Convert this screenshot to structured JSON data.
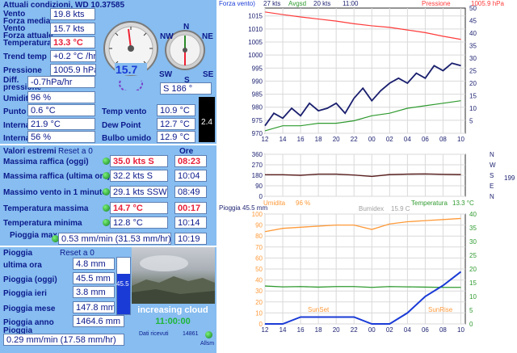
{
  "current": {
    "title": "Attuali condizioni, WD 10.37585",
    "vento_label": "Vento",
    "vento_value": "19.8 kts",
    "forza_media_label": "Forza media",
    "vento2_label": "Vento",
    "vento2_value": "15.7 kts",
    "forza_attuale_label": "Forza attuale",
    "temperatura_label": "Temperatura",
    "temperatura_value": "13.3 °C",
    "trend_label": "Trend temp",
    "trend_value": "+0.2 °C /hr",
    "pressione_label": "Pressione",
    "pressione_value": "1005.9 hPa",
    "diff_label1": "Diff.",
    "diff_label2": "pressione",
    "diff_value": "-0.7hPa/hr",
    "umidita_label": "Umidita",
    "umidita_value": "96 %",
    "punto_label": "Punto dep.",
    "punto_value": "0.6 °C",
    "interna_temp_label": "Interna temp.",
    "interna_temp_value": "21.9 °C",
    "interna_hum_label": "Interna hum",
    "interna_hum_value": "56 %",
    "temp_vento_label": "Temp vento",
    "temp_vento_value": "10.9 °C",
    "dew_label": "Dew Point",
    "dew_value": "12.7 °C",
    "bulbo_label": "Bulbo umido",
    "bulbo_value": "12.9 °C",
    "gauge_speed": "15.7",
    "compass_N": "N",
    "compass_NE": "NE",
    "compass_NW": "NW",
    "compass_SW": "SW",
    "compass_SE": "SE",
    "compass_S": "S",
    "compass_readout": "S   186 °",
    "uv_value": "2.4"
  },
  "extremes": {
    "title": "Valori estremi",
    "reset": "Reset a 0",
    "ore_label": "Ore",
    "rows": [
      {
        "label": "Massima raffica (oggi)",
        "value": "35.0 kts   S",
        "time": "08:23",
        "red": true
      },
      {
        "label": "Massima raffica (ultima ora)",
        "value": "32.2 kts   S",
        "time": "10:04",
        "red": false
      },
      {
        "label": "Massimo vento in 1 minuto",
        "value": "29.1 kts SSW",
        "time": "08:49",
        "red": false
      },
      {
        "label": "Temperatura massima",
        "value": "14.7 °C",
        "time": "00:17",
        "red": true
      },
      {
        "label": "Temperatura minima",
        "value": "12.8 °C",
        "time": "10:14",
        "red": false
      }
    ],
    "pioggia_max_label": "Pioggia max",
    "pioggia_max_value": "0.53 mm/min (31.53 mm/hr)",
    "pioggia_max_time": "10:19"
  },
  "rain": {
    "title": "Pioggia",
    "reset": "Reset a 0",
    "ultima_ora_label": "ultima ora",
    "ultima_ora_value": "4.8 mm",
    "oggi_label": "Pioggia (oggi)",
    "oggi_value": "45.5 mm",
    "ieri_label": "Pioggia ieri",
    "ieri_value": "3.8 mm",
    "mese_label": "Pioggia mese",
    "mese_value": "147.8 mm",
    "anno_label": "Pioggia anno",
    "anno_value": "1464.6 mm",
    "pioggia_label": "Pioggia",
    "pioggia_value": "0.29 mm/min (17.58 mm/hr)",
    "bar_value": "45.5",
    "bar_fraction": 0.72
  },
  "status": {
    "condition": "increasing cloud",
    "time": "11:00:00",
    "dati_label": "Dati ricevuti",
    "dati_count": "14861",
    "allsm": "Allsm"
  },
  "colors": {
    "panel": "#87bdf0",
    "label": "#0b1a8c",
    "red": "#e8203a",
    "pressure": "#ff3b3b",
    "wind": "#1a1f6e",
    "wind_avg": "#2f9a2f",
    "humidity": "#ff9a3a",
    "temperature": "#2f9a2f",
    "rain_line": "#1a3bd6"
  },
  "chart_data": [
    {
      "type": "line",
      "legend": [
        "Forza vento)",
        "27 kts",
        "Avgsd",
        "20 kts",
        "11:00",
        "Pressione",
        "1005.9 hPa"
      ],
      "x_ticks": [
        "12",
        "14",
        "16",
        "18",
        "20",
        "22",
        "00",
        "02",
        "04",
        "06",
        "08",
        "10"
      ],
      "y_left_ticks": [
        "970",
        "975",
        "980",
        "985",
        "990",
        "995",
        "1000",
        "1005",
        "1010",
        "1015"
      ],
      "y_right_ticks": [
        "5",
        "10",
        "15",
        "20",
        "25",
        "30",
        "35",
        "40",
        "45",
        "50"
      ],
      "ylim_left": [
        970,
        1018
      ],
      "ylim_right": [
        0,
        50
      ],
      "series": [
        {
          "name": "Pressione",
          "axis": "left",
          "x": [
            12,
            14,
            16,
            18,
            20,
            22,
            24,
            26,
            28,
            30,
            32,
            34
          ],
          "values": [
            1016.5,
            1015.5,
            1014.6,
            1013.8,
            1013.0,
            1012.0,
            1011.2,
            1010.6,
            1009.6,
            1008.6,
            1007.2,
            1006.0
          ]
        },
        {
          "name": "Forza vento",
          "axis": "right",
          "x": [
            12,
            13,
            14,
            15,
            16,
            17,
            18,
            19,
            20,
            21,
            22,
            23,
            24,
            25,
            26,
            27,
            28,
            29,
            30,
            31,
            32,
            33,
            34
          ],
          "values": [
            3,
            8,
            6,
            10,
            7,
            12,
            9,
            10,
            12,
            8,
            14,
            18,
            13,
            17,
            20,
            22,
            20,
            24,
            22,
            27,
            25,
            28,
            27
          ]
        },
        {
          "name": "Avgsd",
          "axis": "right",
          "x": [
            12,
            14,
            16,
            18,
            20,
            22,
            24,
            26,
            28,
            30,
            32,
            34
          ],
          "values": [
            1,
            3,
            3,
            4,
            4,
            5,
            7,
            8,
            10,
            11,
            12,
            13
          ]
        }
      ]
    },
    {
      "type": "line",
      "x_ticks": [
        "12",
        "14",
        "16",
        "18",
        "20",
        "22",
        "00",
        "02",
        "04",
        "06",
        "08",
        "10"
      ],
      "y_left_ticks": [
        "0",
        "90",
        "180",
        "270",
        "360"
      ],
      "y_right_ticks": [
        "N",
        "W",
        "S",
        "E",
        "N"
      ],
      "right_value": "199",
      "ylim": [
        0,
        360
      ],
      "series": [
        {
          "name": "Direzione",
          "x": [
            12,
            14,
            16,
            18,
            20,
            22,
            24,
            26,
            28,
            30,
            32,
            34
          ],
          "values": [
            185,
            185,
            180,
            190,
            190,
            182,
            170,
            186,
            190,
            192,
            188,
            186
          ]
        }
      ]
    },
    {
      "type": "line",
      "header_left_label": "Pioggia",
      "header_left_value": "45.5 mm",
      "legend": [
        "Umidita",
        "96 %",
        "Bumidex",
        "15.9 C",
        "Temperatura",
        "13.3 °C"
      ],
      "x_ticks": [
        "12",
        "14",
        "16",
        "18",
        "20",
        "22",
        "00",
        "02",
        "04",
        "06",
        "08",
        "10"
      ],
      "y_left_ticks": [
        "0",
        "10",
        "20",
        "30",
        "40",
        "50",
        "60",
        "70",
        "80",
        "90",
        "100"
      ],
      "y_right_ticks": [
        "0",
        "5",
        "10",
        "15",
        "20",
        "25",
        "30",
        "35",
        "40"
      ],
      "ylim_left": [
        0,
        100
      ],
      "ylim_right": [
        0,
        40
      ],
      "annotations": [
        "SunSet",
        "SunRise"
      ],
      "series": [
        {
          "name": "Umidita",
          "axis": "left",
          "x": [
            12,
            14,
            16,
            18,
            20,
            22,
            24,
            26,
            28,
            30,
            32,
            34
          ],
          "values": [
            84,
            87,
            88,
            89,
            90,
            90,
            86,
            91,
            93,
            94,
            95,
            96
          ]
        },
        {
          "name": "Temperatura",
          "axis": "right",
          "x": [
            12,
            14,
            16,
            18,
            20,
            22,
            24,
            26,
            28,
            30,
            32,
            34
          ],
          "values": [
            13.8,
            13.5,
            13.6,
            13.4,
            13.6,
            13.6,
            13.3,
            13.6,
            13.5,
            13.4,
            13.3,
            13.3
          ]
        },
        {
          "name": "Pioggia",
          "axis": "right",
          "x": [
            12,
            14,
            16,
            18,
            20,
            22,
            24,
            26,
            28,
            30,
            32,
            34
          ],
          "values": [
            0,
            0,
            2.5,
            2.5,
            2.5,
            2.5,
            0,
            0,
            4,
            10,
            14,
            19
          ]
        }
      ]
    }
  ]
}
